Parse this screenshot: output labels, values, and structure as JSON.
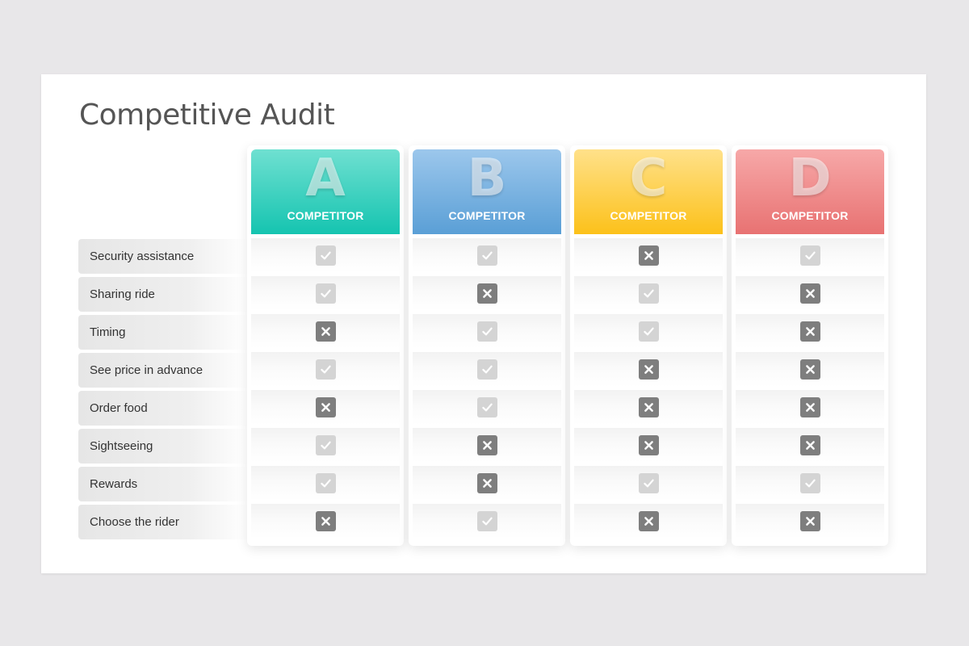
{
  "title": "Competitive Audit",
  "features": [
    "Security assistance",
    "Sharing ride",
    "Timing",
    "See price in advance",
    "Order food",
    "Sightseeing",
    "Rewards",
    "Choose the rider"
  ],
  "competitors": [
    {
      "letter": "A",
      "label": "COMPETITOR",
      "color_top": "#6fe0d1",
      "color_bottom": "#15c4b0",
      "support": [
        true,
        true,
        false,
        true,
        false,
        true,
        true,
        false
      ]
    },
    {
      "letter": "B",
      "label": "COMPETITOR",
      "color_top": "#9cc7ec",
      "color_bottom": "#5a9fd6",
      "support": [
        true,
        false,
        true,
        true,
        true,
        false,
        false,
        true
      ]
    },
    {
      "letter": "C",
      "label": "COMPETITOR",
      "color_top": "#ffe18a",
      "color_bottom": "#fcc11a",
      "support": [
        false,
        true,
        true,
        false,
        false,
        false,
        true,
        false
      ]
    },
    {
      "letter": "D",
      "label": "COMPETITOR",
      "color_top": "#f7a8a8",
      "color_bottom": "#e87272",
      "support": [
        true,
        false,
        false,
        false,
        false,
        false,
        true,
        false
      ]
    }
  ],
  "icons": {
    "yes": "checkmark-icon",
    "no": "cross-icon"
  }
}
